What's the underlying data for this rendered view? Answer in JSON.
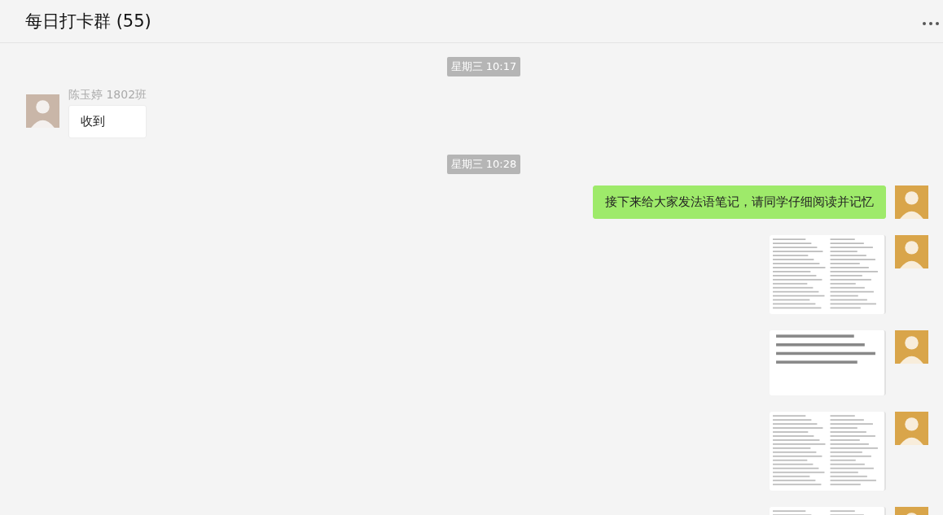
{
  "window": {
    "title": "每日打卡群 (55)"
  },
  "messages": [
    {
      "kind": "time",
      "text": "星期三 10:17"
    },
    {
      "kind": "text",
      "outgoing": false,
      "sender": "陈玉婷 1802班",
      "text": "收到"
    },
    {
      "kind": "time",
      "text": "星期三 10:28"
    },
    {
      "kind": "text",
      "outgoing": true,
      "text": "接下来给大家发法语笔记，请同学仔细阅读并记忆"
    },
    {
      "kind": "image",
      "outgoing": true
    },
    {
      "kind": "image",
      "outgoing": true
    },
    {
      "kind": "image",
      "outgoing": true
    },
    {
      "kind": "image",
      "outgoing": true
    }
  ]
}
